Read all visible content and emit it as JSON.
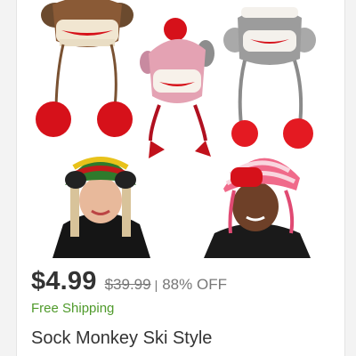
{
  "product": {
    "image": {
      "icon": "sock-monkey-hats-photo",
      "description": ""
    },
    "price": "$4.99",
    "original_price": "$39.99",
    "separator": "|",
    "discount": "88% OFF",
    "shipping": "Free Shipping",
    "title": "Sock Monkey Ski Style"
  },
  "colors": {
    "price": "#333333",
    "muted": "#777777",
    "shipping": "#4f9a2b",
    "pom_red": "#d6111a"
  }
}
